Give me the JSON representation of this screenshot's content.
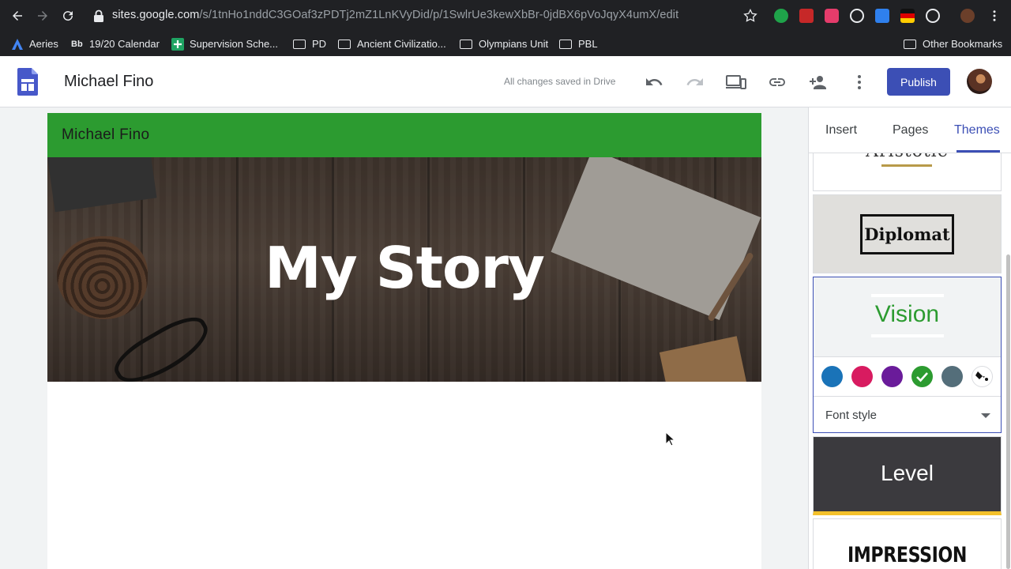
{
  "browser": {
    "url_host": "sites.google.com",
    "url_path": "/s/1tnHo1nddC3GOaf3zPDTj2mZ1LnKVyDid/p/1SwlrUe3kewXbBr-0jdBX6pVoJqyX4umX/edit",
    "bookmarks": [
      {
        "label": "Aeries"
      },
      {
        "label": "19/20 Calendar"
      },
      {
        "label": "Supervision Sche..."
      },
      {
        "label": "PD"
      },
      {
        "label": "Ancient Civilizatio..."
      },
      {
        "label": "Olympians Unit"
      },
      {
        "label": "PBL"
      }
    ],
    "other_bookmarks": "Other Bookmarks"
  },
  "appbar": {
    "title": "Michael Fino",
    "status": "All changes saved in Drive",
    "publish_label": "Publish"
  },
  "page": {
    "header_title": "Michael Fino",
    "banner_title": "My Story",
    "header_color": "#2c9b30"
  },
  "panel": {
    "tabs": [
      {
        "label": "Insert"
      },
      {
        "label": "Pages"
      },
      {
        "label": "Themes"
      }
    ],
    "themes": {
      "aristotle": "Aristotle",
      "diplomat": "Diplomat",
      "vision": "Vision",
      "level": "Level",
      "impression": "IMPRESSION"
    },
    "vision_colors": [
      "#1a73b8",
      "#d81b60",
      "#6a1b9a",
      "#2c9b30",
      "#546e7a"
    ],
    "selected_color": "#2c9b30",
    "font_style_label": "Font style"
  }
}
